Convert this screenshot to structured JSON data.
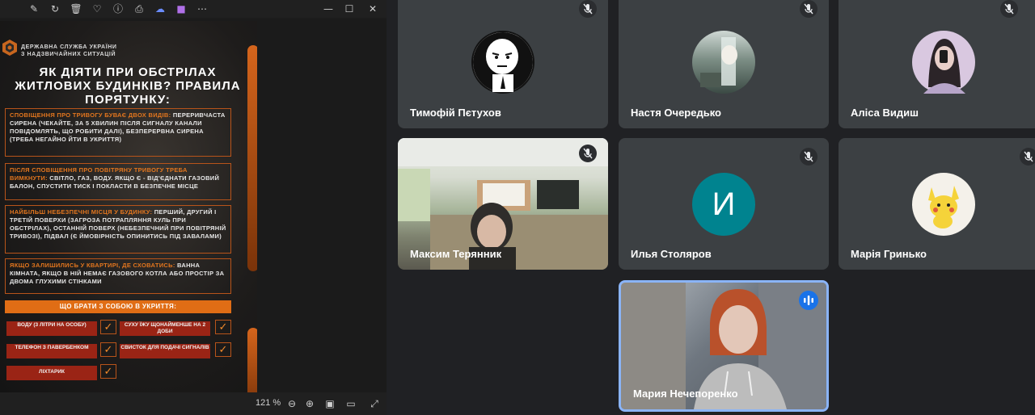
{
  "viewer": {
    "toolbar": {
      "icons": [
        "edit-icon",
        "rotate-icon",
        "delete-icon",
        "favorite-icon",
        "info-icon",
        "print-icon",
        "onedrive-icon",
        "editor-icon",
        "more-icon"
      ],
      "window_controls": [
        "minimize-icon",
        "maximize-icon",
        "close-icon"
      ]
    },
    "status": {
      "zoom": "121 %"
    },
    "poster": {
      "org_line1": "ДЕРЖАВНА СЛУЖБА УКРАЇНИ",
      "org_line2": "З НАДЗВИЧАЙНИХ СИТУАЦІЙ",
      "title": "ЯК ДІЯТИ ПРИ ОБСТРІЛАХ ЖИТЛОВИХ БУДИНКІВ? ПРАВИЛА ПОРЯТУНКУ:",
      "box1_hl": "СПОВІЩЕННЯ ПРО ТРИВОГУ БУВАЄ ДВОХ ВИДІВ:",
      "box1_text": " ПЕРЕРИВЧАСТА СИРЕНА (ЧЕКАЙТЕ, ЗА 5 ХВИЛИН ПІСЛЯ СИГНАЛУ КАНАЛИ ПОВІДОМЛЯТЬ, ЩО РОБИТИ ДАЛІ), БЕЗПЕРЕРВНА СИРЕНА (ТРЕБА НЕГАЙНО ЙТИ В УКРИТТЯ)",
      "box2_hl": "ПІСЛЯ СПОВІЩЕННЯ ПРО ПОВІТРЯНУ ТРИВОГУ ТРЕБА ВИМКНУТИ:",
      "box2_text": " СВІТЛО, ГАЗ, ВОДУ. ЯКЩО Є - ВІД'ЄДНАТИ ГАЗОВИЙ БАЛОН, СПУСТИТИ ТИСК І ПОКЛАСТИ В БЕЗПЕЧНЕ МІСЦЕ",
      "box3_hl": "НАЙБІЛЬШ НЕБЕЗПЕЧНІ МІСЦЯ У БУДИНКУ:",
      "box3_text": " ПЕРШИЙ, ДРУГИЙ І ТРЕТІЙ ПОВЕРХИ (ЗАГРОЗА ПОТРАПЛЯННЯ КУЛЬ ПРИ ОБСТРІЛАХ), ОСТАННІЙ ПОВЕРХ (НЕБЕЗПЕЧНИЙ ПРИ ПОВІТРЯНІЙ ТРИВОЗІ), ПІДВАЛ (Є ЙМОВІРНІСТЬ ОПИНИТИСЬ ПІД ЗАВАЛАМИ)",
      "box4_hl": "ЯКЩО ЗАЛИШИЛИСЬ У КВАРТИРІ, ДЕ СХОВАТИСЬ:",
      "box4_text": " ВАННА КІМНАТА, ЯКЩО В НІЙ НЕМАЄ ГАЗОВОГО КОТЛА АБО ПРОСТІР ЗА ДВОМА ГЛУХИМИ СТІНКАМИ",
      "bar": "ЩО БРАТИ З СОБОЮ В УКРИТТЯ:",
      "items": [
        "ВОДУ (3 ЛІТРИ НА ОСОБУ)",
        "СУХУ ЇЖУ ЩОНАЙМЕНШЕ НА 2 ДОБИ",
        "ТЕЛЕФОН З ПАВЕРБЕНКОМ",
        "СВИСТОК ДЛЯ ПОДАЧІ СИГНАЛІВ",
        "ЛІХТАРИК"
      ]
    }
  },
  "participants": [
    {
      "name": "Тимофій Пєтухов",
      "muted": true,
      "avatar": "meme-face-icon"
    },
    {
      "name": "Настя Очередько",
      "muted": true,
      "avatar": "anime-character-icon"
    },
    {
      "name": "Аліса Видиш",
      "muted": true,
      "avatar": "girl-with-phone-icon"
    },
    {
      "name": "Максим Терянник",
      "muted": true,
      "video": true
    },
    {
      "name": "Илья Столяров",
      "muted": true,
      "avatar_letter": "И",
      "avatar_color": "#00838f"
    },
    {
      "name": "Марія Гринько",
      "muted": true,
      "avatar": "pikachu-icon"
    },
    {
      "name": "Мария Нечепоренко",
      "speaking": true,
      "video": true
    }
  ],
  "colors": {
    "background": "#202124",
    "tile": "#3c4043",
    "speaker_border": "#8ab4f8",
    "speaking_badge": "#1a73e8"
  }
}
